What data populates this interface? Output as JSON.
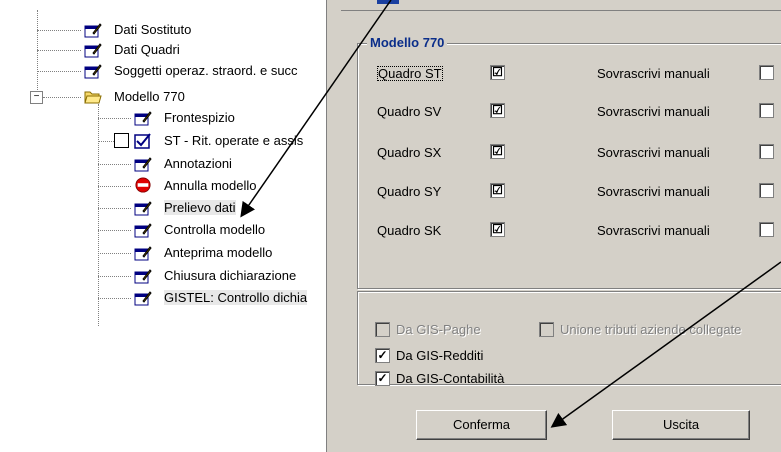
{
  "tree": {
    "items": [
      {
        "label": "Dati Sostituto"
      },
      {
        "label": "Dati Quadri"
      },
      {
        "label": "Soggetti operaz. straord. e succ"
      },
      {
        "label": "Modello 770",
        "expander": "⊟"
      },
      {
        "label": "Frontespizio"
      },
      {
        "label": "ST - Rit. operate e assis"
      },
      {
        "label": "Annotazioni"
      },
      {
        "label": "Annulla modello"
      },
      {
        "label": "Prelievo dati"
      },
      {
        "label": "Controlla modello"
      },
      {
        "label": "Anteprima modello"
      },
      {
        "label": "Chiusura dichiarazione"
      },
      {
        "label": "GISTEL: Controllo dichia"
      }
    ]
  },
  "modello": {
    "title": "Modello 770",
    "rows": [
      {
        "label": "Quadro ST",
        "checked": "☑",
        "overwrite_label": "Sovrascrivi manuali"
      },
      {
        "label": "Quadro SV",
        "checked": "☑",
        "overwrite_label": "Sovrascrivi manuali"
      },
      {
        "label": "Quadro SX",
        "checked": "☑",
        "overwrite_label": "Sovrascrivi manuali"
      },
      {
        "label": "Quadro SY",
        "checked": "☑",
        "overwrite_label": "Sovrascrivi manuali"
      },
      {
        "label": "Quadro SK",
        "checked": "☑",
        "overwrite_label": "Sovrascrivi manuali"
      }
    ]
  },
  "sources": {
    "gis_paghe": "Da GIS-Paghe",
    "unione_tributi": "Unione tributi aziende collegate",
    "gis_redditi": "Da GIS-Redditi",
    "gis_contabilita": "Da GIS-Contabilità"
  },
  "buttons": {
    "confirm": "Conferma",
    "exit": "Uscita"
  },
  "colors": {
    "accent": "#0b2e8a",
    "panel": "#d4d0c8"
  }
}
